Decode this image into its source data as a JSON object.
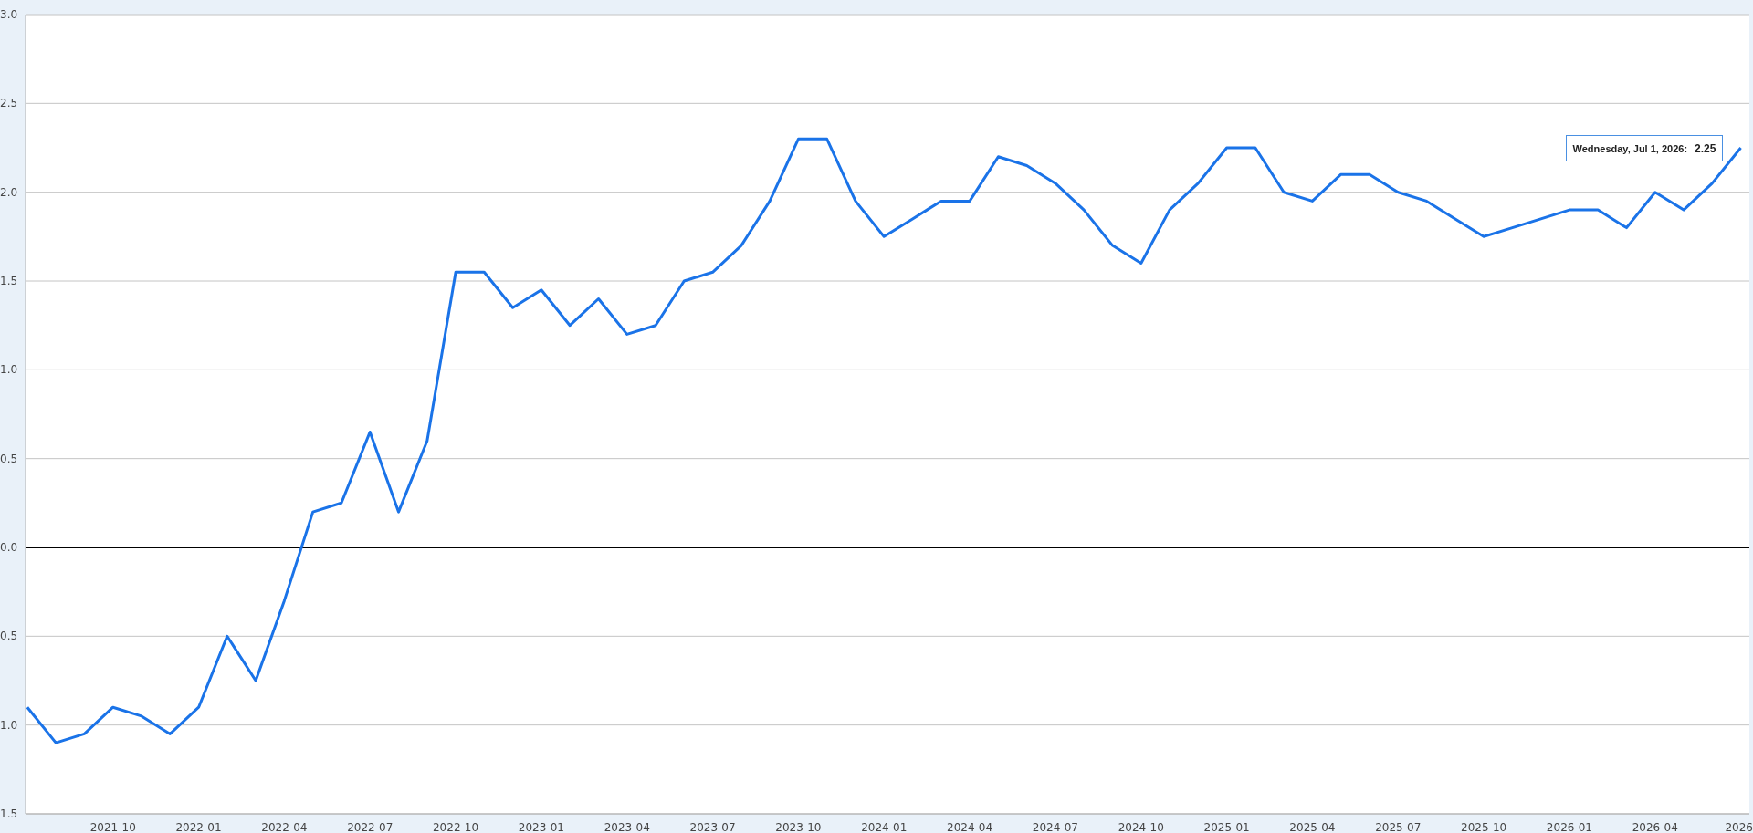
{
  "chart": {
    "chart_data": {
      "type": "line",
      "categories": [
        null,
        null,
        null,
        "2021-10",
        null,
        null,
        "2022-01",
        null,
        null,
        "2022-04",
        null,
        null,
        "2022-07",
        null,
        null,
        "2022-10",
        null,
        null,
        "2023-01",
        null,
        null,
        "2023-04",
        null,
        null,
        "2023-07",
        null,
        null,
        "2023-10",
        null,
        null,
        "2024-01",
        null,
        null,
        "2024-04",
        null,
        null,
        "2024-07",
        null,
        null,
        "2024-10",
        null,
        null,
        "2025-01",
        null,
        null,
        "2025-04",
        null,
        null,
        "2025-07",
        null,
        null,
        "2025-10",
        null,
        null,
        "2026-01",
        null,
        null,
        "2026-04",
        null,
        null,
        "2026"
      ],
      "series": [
        {
          "color": "#1a73e8",
          "values": [
            -0.9,
            -1.1,
            -1.05,
            -0.9,
            -0.95,
            -1.05,
            -0.9,
            -0.5,
            -0.75,
            -0.3,
            0.2,
            0.25,
            0.65,
            0.2,
            0.6,
            1.55,
            1.55,
            1.35,
            1.45,
            1.25,
            1.4,
            1.2,
            1.25,
            1.5,
            1.55,
            1.7,
            1.95,
            2.3,
            2.3,
            1.95,
            1.75,
            1.85,
            1.95,
            1.95,
            2.2,
            2.15,
            2.05,
            1.9,
            1.7,
            1.6,
            1.9,
            2.05,
            2.25,
            2.25,
            2.0,
            1.95,
            2.1,
            2.1,
            2.0,
            1.95,
            1.85,
            1.75,
            1.8,
            1.85,
            1.9,
            1.9,
            1.8,
            2.0,
            1.9,
            2.05,
            2.25
          ]
        }
      ],
      "ylim": [
        -1.5,
        3.0
      ],
      "grid": true,
      "yticks": [
        {
          "value": 3.0,
          "label": "3.0"
        },
        {
          "value": 2.5,
          "label": "2.5"
        },
        {
          "value": 2.0,
          "label": "2.0"
        },
        {
          "value": 1.5,
          "label": "1.5"
        },
        {
          "value": 1.0,
          "label": "1.0"
        },
        {
          "value": 0.5,
          "label": "0.5"
        },
        {
          "value": 0.0,
          "label": "0.0"
        },
        {
          "value": -0.5,
          "label": "0.5"
        },
        {
          "value": -1.0,
          "label": "1.0"
        },
        {
          "value": -1.5,
          "label": "1.5"
        }
      ]
    },
    "tooltip": {
      "label": "Wednesday, Jul 1, 2026:",
      "value": "2.25"
    }
  }
}
